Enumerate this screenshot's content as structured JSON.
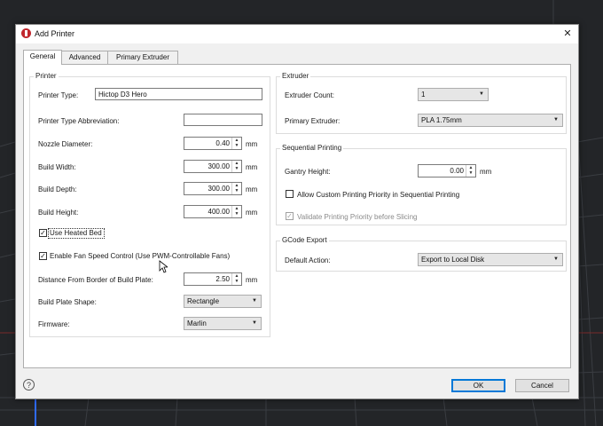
{
  "window": {
    "title": "Add Printer",
    "close_glyph": "✕"
  },
  "tabs": [
    {
      "label": "General",
      "active": true
    },
    {
      "label": "Advanced",
      "active": false
    },
    {
      "label": "Primary Extruder",
      "active": false
    }
  ],
  "printer_group": {
    "title": "Printer",
    "printer_type": {
      "label": "Printer Type:",
      "value": "Hictop D3 Hero"
    },
    "abbreviation": {
      "label": "Printer Type Abbreviation:",
      "value": ""
    },
    "nozzle_diameter": {
      "label": "Nozzle Diameter:",
      "value": "0.40",
      "unit": "mm"
    },
    "build_width": {
      "label": "Build Width:",
      "value": "300.00",
      "unit": "mm"
    },
    "build_depth": {
      "label": "Build Depth:",
      "value": "300.00",
      "unit": "mm"
    },
    "build_height": {
      "label": "Build Height:",
      "value": "400.00",
      "unit": "mm"
    },
    "heated_bed": {
      "label": "Use Heated Bed",
      "checked": true,
      "check_glyph": "✓"
    },
    "fan_speed": {
      "label": "Enable Fan Speed Control (Use PWM-Controllable Fans)",
      "checked": true,
      "check_glyph": "✓"
    },
    "border_distance": {
      "label": "Distance From Border of Build Plate:",
      "value": "2.50",
      "unit": "mm"
    },
    "plate_shape": {
      "label": "Build Plate Shape:",
      "value": "Rectangle"
    },
    "firmware": {
      "label": "Firmware:",
      "value": "Marlin"
    }
  },
  "extruder_group": {
    "title": "Extruder",
    "count": {
      "label": "Extruder Count:",
      "value": "1"
    },
    "primary": {
      "label": "Primary Extruder:",
      "value": "PLA 1.75mm"
    }
  },
  "sequential_group": {
    "title": "Sequential Printing",
    "gantry": {
      "label": "Gantry Height:",
      "value": "0.00",
      "unit": "mm"
    },
    "custom_priority": {
      "label": "Allow Custom Printing Priority in Sequential Printing",
      "checked": false,
      "check_glyph": ""
    },
    "validate_priority": {
      "label": "Validate Printing Priority before Slicing",
      "checked": true,
      "disabled": true,
      "check_glyph": "✓"
    }
  },
  "gcode_group": {
    "title": "GCode Export",
    "default_action": {
      "label": "Default Action:",
      "value": "Export to Local Disk"
    }
  },
  "footer": {
    "help_glyph": "?",
    "ok_label": "OK",
    "cancel_label": "Cancel"
  },
  "glyphs": {
    "spin_up": "▲",
    "spin_down": "▼",
    "dropdown": "▼"
  },
  "colors": {
    "accent": "#0078d7",
    "logo": "#c1272d",
    "viewport": "#232528"
  }
}
